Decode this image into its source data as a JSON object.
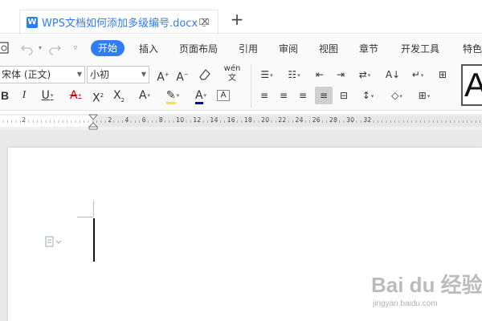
{
  "tab": {
    "logo": "W",
    "title": "WPS文档如何添加多级编号.docx",
    "close": "×",
    "new_tab": "+"
  },
  "menu": {
    "items": [
      "开始",
      "插入",
      "页面布局",
      "引用",
      "审阅",
      "视图",
      "章节",
      "开发工具",
      "特色"
    ],
    "active": "开始"
  },
  "ribbon": {
    "font_name": "宋体 (正文)",
    "font_size": "小初",
    "style_preview": "A"
  },
  "ruler": {
    "numbers": [
      "2",
      "2",
      "4",
      "6",
      "8",
      "10",
      "12",
      "14",
      "16",
      "18",
      "20",
      "22",
      "24",
      "26",
      "28",
      "30",
      "32"
    ]
  },
  "watermark": {
    "brand": "Bai du 经验",
    "url": "jingyan.baidu.com"
  },
  "colors": {
    "accent": "#2e7cf6",
    "highlight": "#f5e33a",
    "font_color": "#0000cc",
    "font_red": "#cc0000"
  }
}
